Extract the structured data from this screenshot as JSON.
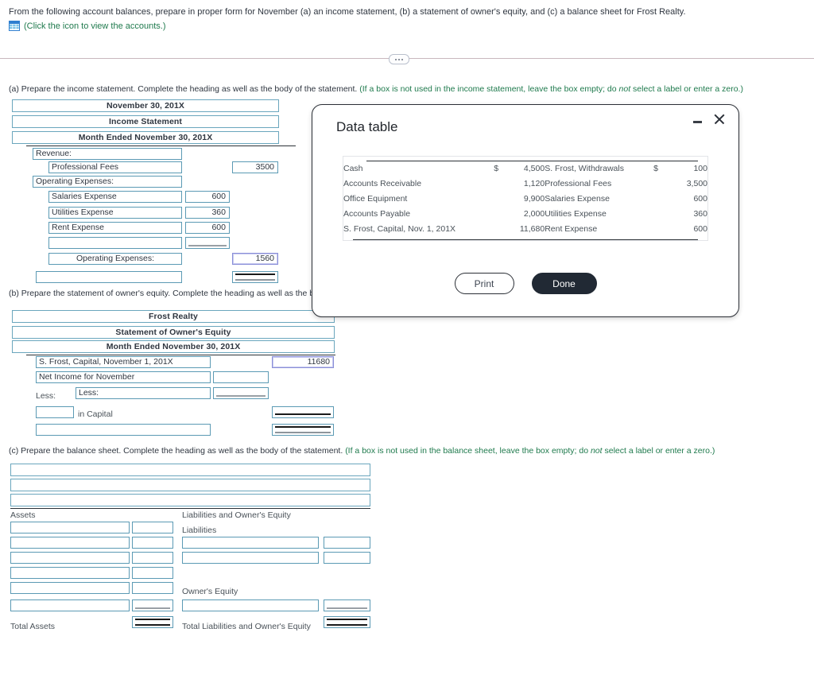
{
  "prompt": {
    "text": "From the following account balances, prepare in proper form for November (a) an income statement, (b) a statement of owner's equity, and (c) a balance sheet for Frost Realty.",
    "icon": "grid-table-icon",
    "link": "(Click the icon to view the accounts.)"
  },
  "sections": {
    "a": {
      "instruction": "(a) Prepare the income statement. Complete the heading as well as the body of the statement.",
      "note_pre": "(If a box is not used in the income statement, leave the box empty; do ",
      "note_italic": "not",
      "note_post": " select a label or enter a zero.)",
      "headers": [
        "November 30, 201X",
        "Income Statement",
        "Month Ended November 30, 201X"
      ],
      "rows": [
        {
          "label": "Revenue:",
          "amount": "",
          "total": ""
        },
        {
          "label": "Professional Fees",
          "amount": "",
          "total": "3500"
        },
        {
          "label": "Operating Expenses:",
          "amount": "",
          "total": ""
        },
        {
          "label": "Salaries Expense",
          "amount": "600",
          "total": ""
        },
        {
          "label": "Utilities Expense",
          "amount": "360",
          "total": ""
        },
        {
          "label": "Rent Expense",
          "amount": "600",
          "total": ""
        },
        {
          "label": "",
          "amount": "",
          "total": ""
        },
        {
          "label": "Operating Expenses:",
          "amount": "",
          "total": "1560"
        },
        {
          "label": "",
          "amount": "",
          "total": ""
        }
      ]
    },
    "b": {
      "instruction": "(b) Prepare the statement of owner's equity. Complete the heading as well as the body",
      "headers": [
        "Frost Realty",
        "Statement of Owner's Equity",
        "Month Ended November 30, 201X"
      ],
      "rows": [
        {
          "label": "S. Frost, Capital, November 1, 201X",
          "amount": "",
          "total": "11680"
        },
        {
          "label": "Net Income for November",
          "amount": "",
          "total": ""
        },
        {
          "label": "Less:",
          "amount": "",
          "total": ""
        },
        {
          "label": "in Capital",
          "amount": "",
          "total": ""
        },
        {
          "label": "",
          "amount": "",
          "total": ""
        }
      ],
      "less_label": "Less:",
      "in_capital_label": "in Capital"
    },
    "c": {
      "instruction": "(c) Prepare the balance sheet. Complete the heading as well as the body of the statement.",
      "note_pre": "(If a box is not used in the balance sheet, leave the box empty; do ",
      "note_italic": "not",
      "note_post": " select a label or enter a zero.)",
      "headers": [
        "",
        "",
        ""
      ],
      "assets_label": "Assets",
      "liab_owner_label": "Liabilities and Owner's Equity",
      "liabilities_label": "Liabilities",
      "owners_equity_label": "Owner's Equity",
      "total_assets_label": "Total Assets",
      "total_liab_label": "Total Liabilities and Owner's Equity"
    }
  },
  "dialog": {
    "title": "Data table",
    "minimize_icon": "minimize-icon",
    "close_icon": "close-icon",
    "print_label": "Print",
    "done_label": "Done",
    "table": {
      "rows": [
        {
          "name": "Cash",
          "dollar": "$",
          "value": "4,500",
          "name2": "S. Frost, Withdrawals",
          "dollar2": "$",
          "value2": "100"
        },
        {
          "name": "Accounts Receivable",
          "dollar": "",
          "value": "1,120",
          "name2": "Professional Fees",
          "dollar2": "",
          "value2": "3,500"
        },
        {
          "name": "Office Equipment",
          "dollar": "",
          "value": "9,900",
          "name2": "Salaries Expense",
          "dollar2": "",
          "value2": "600"
        },
        {
          "name": "Accounts Payable",
          "dollar": "",
          "value": "2,000",
          "name2": "Utilities Expense",
          "dollar2": "",
          "value2": "360"
        },
        {
          "name": "S. Frost, Capital, Nov. 1, 201X",
          "dollar": "",
          "value": "11,680",
          "name2": "Rent Expense",
          "dollar2": "",
          "value2": "600"
        }
      ]
    }
  },
  "colors": {
    "box_border": "#5b9ab4",
    "link_green": "#1f7a4d",
    "text": "#2f3640",
    "done_bg": "#212934",
    "divider": "#c9b7bd"
  }
}
